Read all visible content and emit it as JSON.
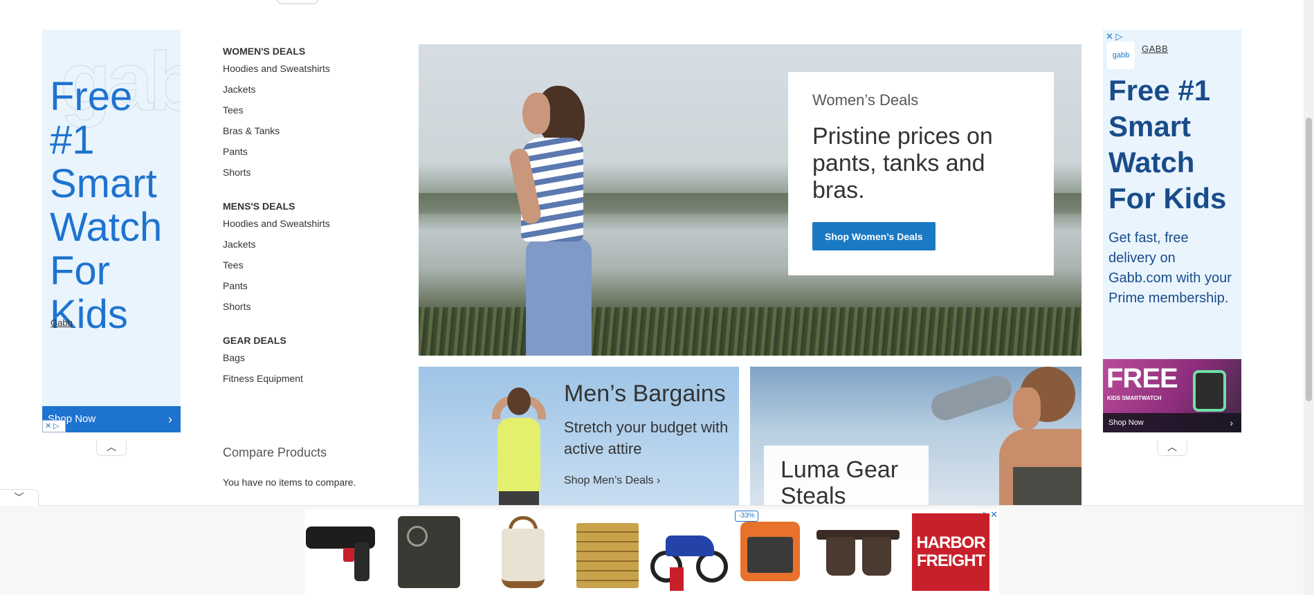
{
  "left_ad": {
    "headline": "Free #1 Smart Watch For Kids",
    "brand": "Gabb",
    "cta": "Shop Now",
    "cta_chevron": "›",
    "adchoices": "✕ ▷"
  },
  "collapse_symbol": "︿",
  "sidebar": {
    "sections": [
      {
        "title": "WOMEN'S DEALS",
        "items": [
          "Hoodies and Sweatshirts",
          "Jackets",
          "Tees",
          "Bras & Tanks",
          "Pants",
          "Shorts"
        ]
      },
      {
        "title": "MENS'S DEALS",
        "items": [
          "Hoodies and Sweatshirts",
          "Jackets",
          "Tees",
          "Pants",
          "Shorts"
        ]
      },
      {
        "title": "GEAR DEALS",
        "items": [
          "Bags",
          "Fitness Equipment"
        ]
      }
    ],
    "compare_title": "Compare Products",
    "compare_text": "You have no items to compare."
  },
  "hero": {
    "eyebrow": "Women’s Deals",
    "headline": "Pristine prices on pants, tanks and bras.",
    "button": "Shop Women’s Deals"
  },
  "men_panel": {
    "title": "Men’s Bargains",
    "subtitle": "Stretch your budget with active attire",
    "link": "Shop Men’s Deals",
    "link_chevron": "›"
  },
  "gear_panel": {
    "title": "Luma Gear Steals"
  },
  "right_ad": {
    "adchoices": "✕ ▷",
    "logo": "gabb",
    "brand": "GABB",
    "headline": "Free #1 Smart Watch For Kids",
    "body": "Get fast, free delivery on Gabb.com with your Prime membership.",
    "banner_big": "FREE",
    "banner_small": "KIDS SMARTWATCH",
    "cta": "Shop Now",
    "cta_chevron": "›"
  },
  "sticky": {
    "toggle_symbol": "﹀",
    "adchoices": "▷✕",
    "discount_badge": "-33%",
    "brand_line1": "HARBOR",
    "brand_line2": "FREIGHT"
  }
}
